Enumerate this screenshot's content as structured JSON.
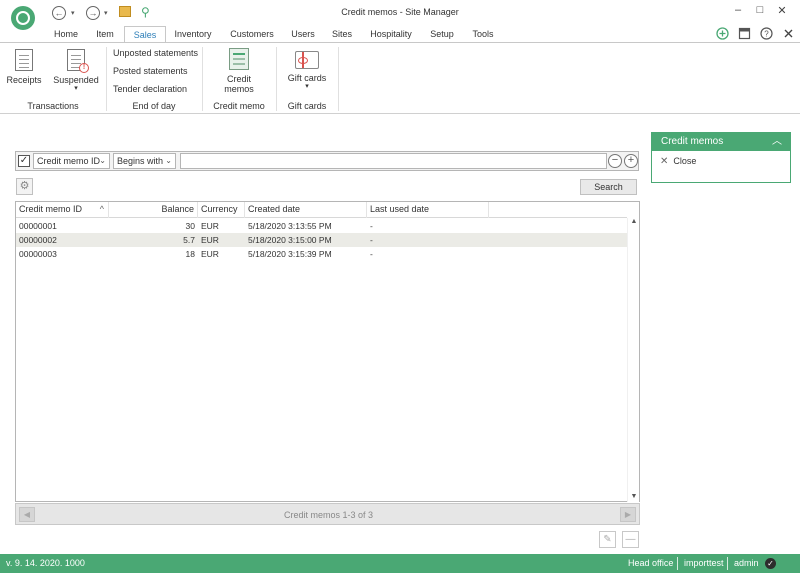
{
  "window": {
    "title": "Credit memos - Site Manager",
    "minimize": "–",
    "maximize": "□",
    "close": "✕"
  },
  "tabs": [
    "Home",
    "Item",
    "Sales",
    "Inventory",
    "Customers",
    "Users",
    "Sites",
    "Hospitality",
    "Setup",
    "Tools"
  ],
  "active_tab": "Sales",
  "ribbon": {
    "receipts": "Receipts",
    "suspended": "Suspended",
    "suspended_arrow": "▾",
    "unposted_statements": "Unposted statements",
    "posted_statements": "Posted statements",
    "tender_declaration": "Tender declaration",
    "credit_memos_line1": "Credit",
    "credit_memos_line2": "memos",
    "gift_cards": "Gift cards",
    "gift_cards_arrow": "▾",
    "groups": {
      "transactions": "Transactions",
      "end_of_day": "End of day",
      "credit_memo": "Credit memo",
      "gift_cards": "Gift cards"
    }
  },
  "filter": {
    "checkbox_mark": "✓",
    "field": "Credit memo ID",
    "operator": "Begins with",
    "value": "",
    "remove": "−",
    "add": "+"
  },
  "search_label": "Search",
  "grid": {
    "columns": [
      "Credit memo ID",
      "Balance",
      "Currency",
      "Created date",
      "Last used date"
    ],
    "sort_indicator": "^",
    "rows": [
      {
        "id": "00000001",
        "balance": "30",
        "currency": "EUR",
        "created": "5/18/2020 3:13:55 PM",
        "last_used": "-"
      },
      {
        "id": "00000002",
        "balance": "5.7",
        "currency": "EUR",
        "created": "5/18/2020 3:15:00 PM",
        "last_used": "-"
      },
      {
        "id": "00000003",
        "balance": "18",
        "currency": "EUR",
        "created": "5/18/2020 3:15:39 PM",
        "last_used": "-"
      }
    ],
    "selected_row": 1
  },
  "pager_text": "Credit memos 1-3 of 3",
  "panel": {
    "title": "Credit memos",
    "close_label": "Close"
  },
  "status": {
    "version": "v. 9. 14. 2020. 1000",
    "location": "Head office",
    "database": "importtest",
    "user": "admin"
  },
  "colors": {
    "accent": "#4aa874",
    "link": "#2e7fb8"
  }
}
